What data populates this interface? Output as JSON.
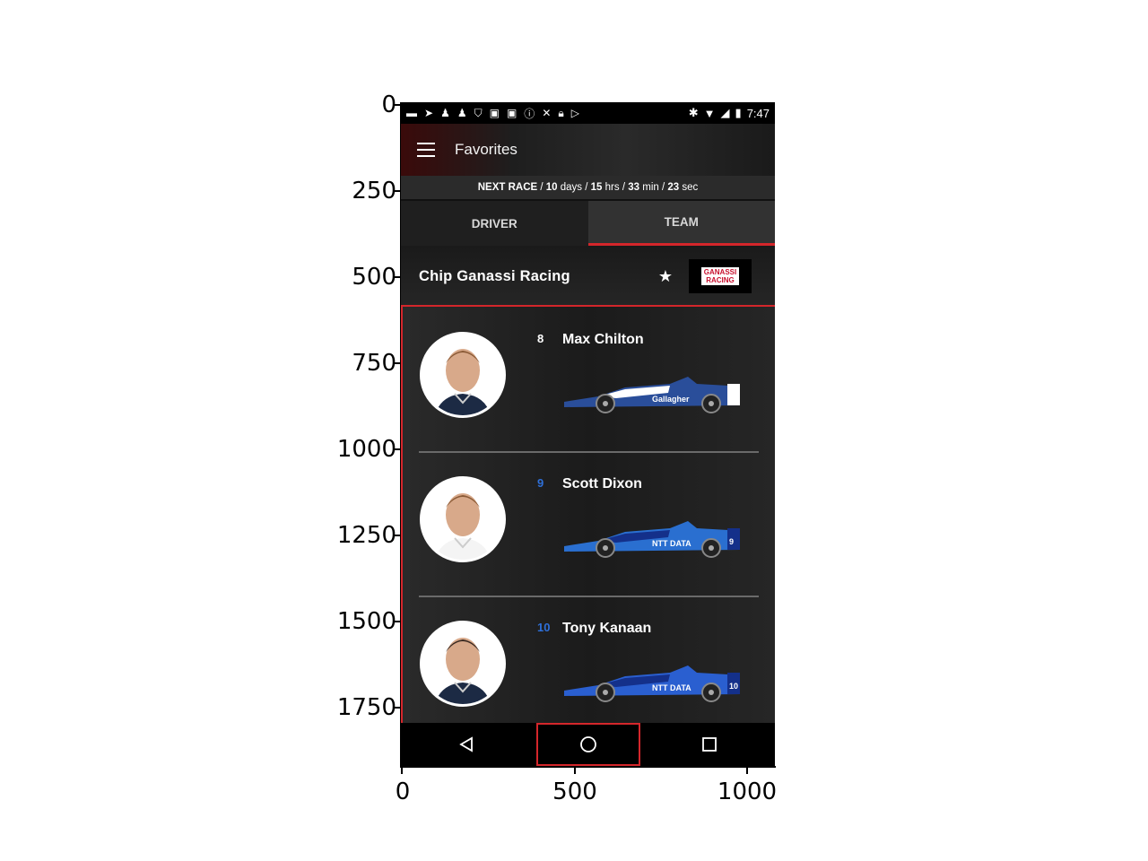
{
  "axes": {
    "y_ticks": [
      "0",
      "250",
      "500",
      "750",
      "1000",
      "1250",
      "1500",
      "1750"
    ],
    "x_ticks": [
      "0",
      "500",
      "1000"
    ]
  },
  "status_bar": {
    "time": "7:47",
    "icons": [
      "message-icon",
      "send-icon",
      "chess-icon",
      "chess-icon",
      "shield-icon",
      "facebook-icon",
      "facebook-icon",
      "info-icon",
      "tools-icon",
      "lock-icon",
      "play-store-icon",
      "bluetooth-icon",
      "wifi-icon",
      "signal-icon",
      "battery-icon"
    ]
  },
  "app_bar": {
    "title": "Favorites"
  },
  "countdown": {
    "label": "NEXT RACE",
    "days": "10",
    "days_unit": "days",
    "hours": "15",
    "hours_unit": "hrs",
    "minutes": "33",
    "minutes_unit": "min",
    "seconds": "23",
    "seconds_unit": "sec"
  },
  "tabs": [
    {
      "label": "DRIVER",
      "selected": false
    },
    {
      "label": "TEAM",
      "selected": true
    }
  ],
  "team": {
    "name": "Chip Ganassi Racing",
    "favorited": true,
    "logo_line1": "GANASSI",
    "logo_line2": "RACING"
  },
  "drivers": [
    {
      "number": "8",
      "name": "Max Chilton",
      "number_color": "#ffffff",
      "car_color": "#2a4e9a",
      "car_accent": "#ffffff",
      "car_sponsor": "Gallagher"
    },
    {
      "number": "9",
      "name": "Scott Dixon",
      "number_color": "#2e6fd8",
      "car_color": "#2a6fd0",
      "car_accent": "#14308a",
      "car_sponsor": "NTT DATA"
    },
    {
      "number": "10",
      "name": "Tony Kanaan",
      "number_color": "#2e6fd8",
      "car_color": "#2a5fd0",
      "car_accent": "#14308a",
      "car_sponsor": "NTT DATA"
    }
  ],
  "nav": {
    "back_icon": "back-triangle-icon",
    "home_icon": "home-circle-icon",
    "recents_icon": "recents-square-icon"
  },
  "colors": {
    "accent": "#d4262b",
    "background": "#1c1c1c"
  }
}
